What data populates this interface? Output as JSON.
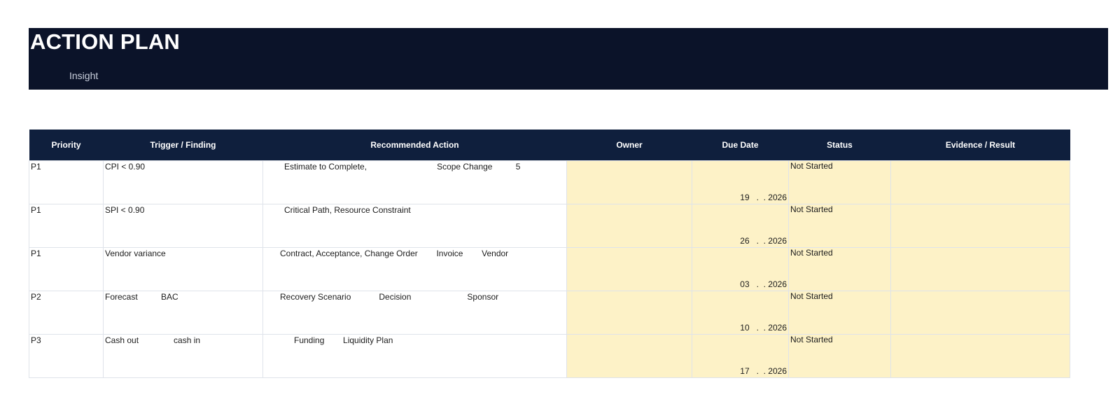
{
  "header": {
    "title": "ACTION PLAN",
    "subtitle": "Insight"
  },
  "table": {
    "columns": [
      "Priority",
      "Trigger / Finding",
      "Recommended Action",
      "Owner",
      "Due Date",
      "Status",
      "Evidence / Result"
    ],
    "rows": [
      {
        "priority": "P1",
        "trigger": "CPI < 0.90",
        "action": "Estimate to Complete,                              Scope Change          5",
        "owner": "",
        "due": "19   .  . 2026",
        "status": "Not Started",
        "evidence": ""
      },
      {
        "priority": "P1",
        "trigger": "SPI < 0.90",
        "action": "Critical Path, Resource Constraint",
        "owner": "",
        "due": "26   .  . 2026",
        "status": "Not Started",
        "evidence": ""
      },
      {
        "priority": "P1",
        "trigger": "Vendor variance",
        "action": "Contract, Acceptance, Change Order        Invoice        Vendor",
        "owner": "",
        "due": "03   .  . 2026",
        "status": "Not Started",
        "evidence": ""
      },
      {
        "priority": "P2",
        "trigger": "Forecast          BAC",
        "action": "Recovery Scenario            Decision                        Sponsor",
        "owner": "",
        "due": "10   .  . 2026",
        "status": "Not Started",
        "evidence": ""
      },
      {
        "priority": "P3",
        "trigger": "Cash out               cash in",
        "action": "Funding        Liquidity Plan",
        "owner": "",
        "due": "17   .  . 2026",
        "status": "Not Started",
        "evidence": ""
      }
    ]
  },
  "colors": {
    "banner_bg": "#0b1329",
    "header_bg": "#0f1f3d",
    "input_fill": "#fdf2c7"
  }
}
